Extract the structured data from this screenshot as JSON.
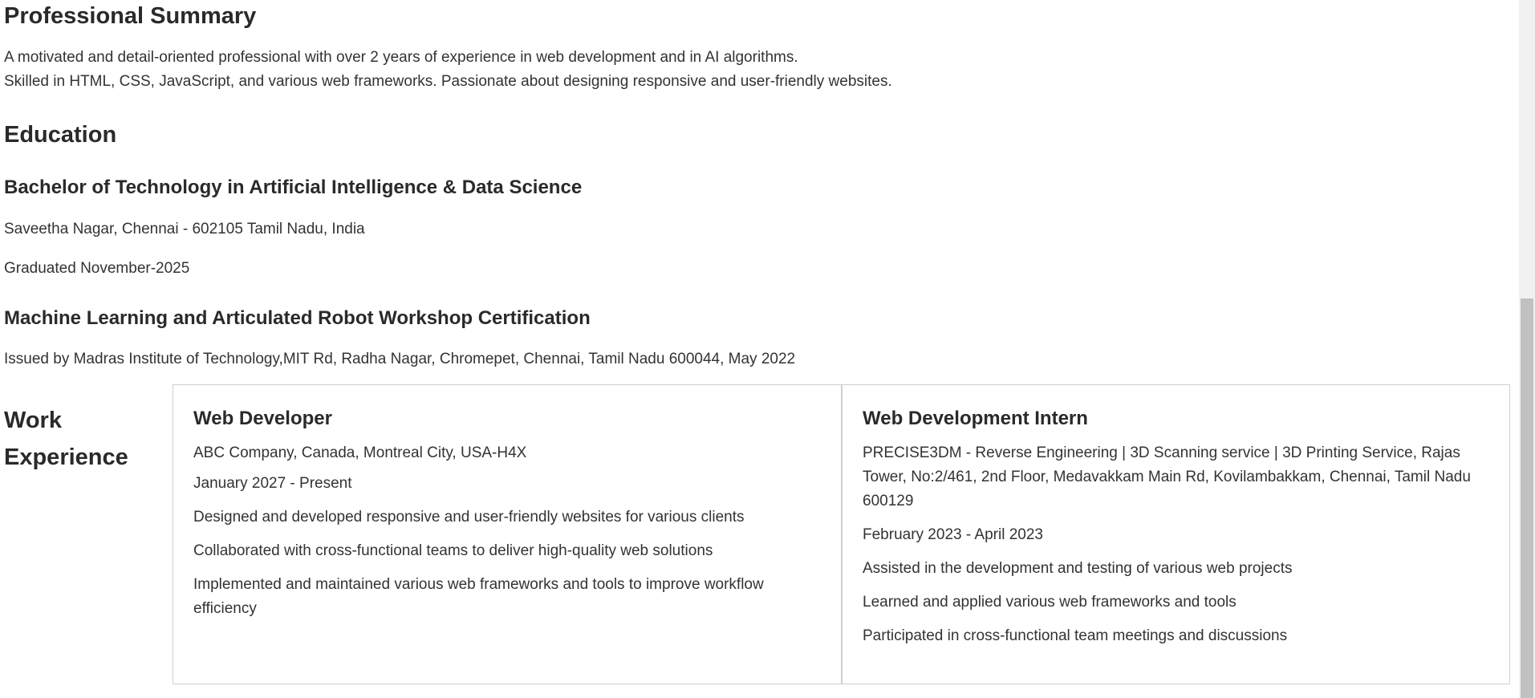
{
  "summary": {
    "heading": "Professional Summary",
    "line1": "A motivated and detail-oriented professional with over 2 years of experience in web development and in AI algorithms.",
    "line2": "Skilled in HTML, CSS, JavaScript, and various web frameworks. Passionate about designing responsive and user-friendly websites."
  },
  "education": {
    "heading": "Education",
    "degree": {
      "title": "Bachelor of Technology in Artificial Intelligence & Data Science",
      "location": "Saveetha Nagar, Chennai - 602105 Tamil Nadu, India",
      "graduated": "Graduated November-2025"
    },
    "certification": {
      "title": "Machine Learning and Articulated Robot Workshop Certification",
      "issued": "Issued by Madras Institute of Technology,MIT Rd, Radha Nagar, Chromepet, Chennai, Tamil Nadu 600044, May 2022"
    }
  },
  "work": {
    "heading_line1": "Work",
    "heading_line2": "Experience",
    "jobs": [
      {
        "title": "Web Developer",
        "company": "ABC Company, Canada, Montreal City, USA-H4X",
        "dates": "January 2027 - Present",
        "duties": [
          "Designed and developed responsive and user-friendly websites for various clients",
          "Collaborated with cross-functional teams to deliver high-quality web solutions",
          "Implemented and maintained various web frameworks and tools to improve workflow efficiency"
        ]
      },
      {
        "title": "Web Development Intern",
        "company": "PRECISE3DM - Reverse Engineering | 3D Scanning service | 3D Printing Service, Rajas Tower, No:2/461, 2nd Floor, Medavakkam Main Rd, Kovilambakkam, Chennai, Tamil Nadu 600129",
        "dates": "February 2023 - April 2023",
        "duties": [
          "Assisted in the development and testing of various web projects",
          "Learned and applied various web frameworks and tools",
          "Participated in cross-functional team meetings and discussions"
        ]
      }
    ]
  }
}
